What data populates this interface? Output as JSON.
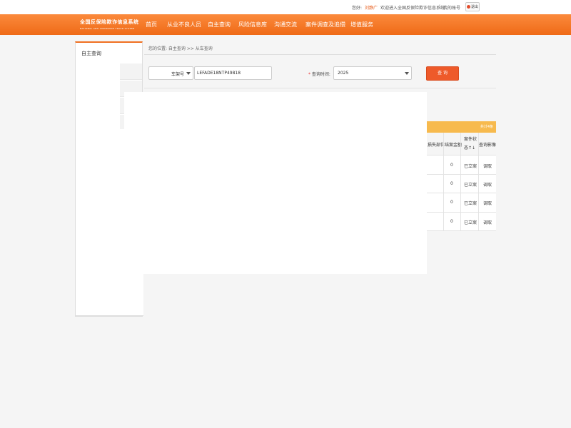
{
  "topbar": {
    "greeting": "您好:",
    "user": "刘静广",
    "welcome": "欢迎进入全国反保险欺诈信息系统",
    "separator": "|",
    "my_account": "我的账号",
    "logout": "退出"
  },
  "logo": {
    "title_cn": "全国反保险欺诈信息系统",
    "title_en": "NATIONAL ANTI INSURANCE FRAUD SYSTEM"
  },
  "nav": [
    "首页",
    "从业不良人员",
    "自主查询",
    "风险信息库",
    "沟通交流",
    "案件调查及追偿",
    "增值服务"
  ],
  "sidebar": {
    "title": "自主查询"
  },
  "breadcrumb": "您的位置: 自主查询 >> 从车查询",
  "search": {
    "type_value": "车架号",
    "vin_value": "LEFADE18NTP49818",
    "time_label": "查询时间:",
    "required_mark": "*",
    "year_value": "2025",
    "query_button": "查 询"
  },
  "table": {
    "total_label": "共计4条",
    "headers": [
      "损失部位",
      "结案金额",
      "案件状态↑↓",
      "查询影像"
    ],
    "rows": [
      [
        "",
        "0",
        "已立案",
        "调取"
      ],
      [
        "",
        "0",
        "已立案",
        "调取"
      ],
      [
        "",
        "0",
        "已立案",
        "调取"
      ],
      [
        "",
        "0",
        "已立案",
        "调取"
      ]
    ]
  },
  "colors": {
    "accent": "#f07020",
    "button": "#ee5a2a",
    "table_header": "#f7ba4e"
  }
}
